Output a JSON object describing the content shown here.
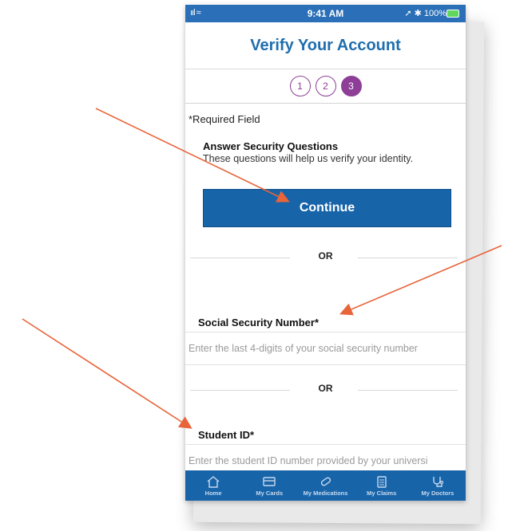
{
  "status_bar": {
    "signal": "ııl ≈",
    "time": "9:41 AM",
    "right": "➚ ✱ 100%"
  },
  "header": {
    "title": "Verify Your Account"
  },
  "steps": [
    "1",
    "2",
    "3"
  ],
  "required_note": "*Required Field",
  "security": {
    "title": "Answer Security Questions",
    "description": "These questions will help us verify your identity.",
    "continue_label": "Continue"
  },
  "separator": "OR",
  "ssn": {
    "label": "Social Security Number*",
    "placeholder": "Enter the last 4-digits of your social security number"
  },
  "student": {
    "label": "Student ID*",
    "placeholder": "Enter the student ID number provided by your universi"
  },
  "tabbar": {
    "items": [
      {
        "label": "Home",
        "icon": "home-icon"
      },
      {
        "label": "My Cards",
        "icon": "card-icon"
      },
      {
        "label": "My Medications",
        "icon": "pill-icon"
      },
      {
        "label": "My Claims",
        "icon": "clipboard-icon"
      },
      {
        "label": "My Doctors",
        "icon": "stethoscope-icon"
      }
    ]
  },
  "colors": {
    "primary": "#1764a9",
    "title": "#1f6eae",
    "step": "#8e3e97",
    "annotation_arrow": "#e8643a"
  }
}
